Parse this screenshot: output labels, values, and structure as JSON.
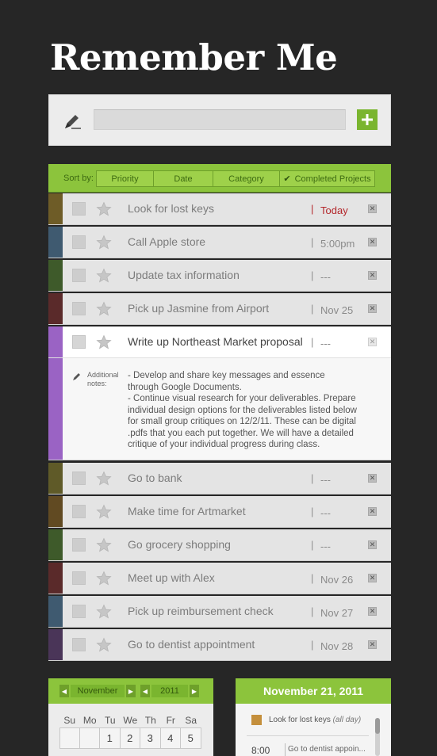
{
  "app": {
    "title": "Remember Me"
  },
  "add_bar": {
    "input_value": "",
    "add_icon": "plus-icon",
    "edit_icon": "pencil-icon"
  },
  "sort": {
    "label": "Sort by:",
    "options": [
      "Priority",
      "Date",
      "Category",
      "Completed Projects"
    ],
    "checked": "Completed Projects"
  },
  "colors": {
    "accent_green": "#8cc43c",
    "today_red": "#b3262a",
    "strip_olive": "#6e5c27",
    "strip_slate": "#3f5a70",
    "strip_moss": "#3e5a2a",
    "strip_maroon": "#5a2a2a",
    "strip_purple": "#9a63c4",
    "strip_gold": "#5f5a28",
    "strip_brown": "#614a22",
    "strip_grape": "#4a3558"
  },
  "tasks": [
    {
      "label": "Look for lost keys",
      "sep": "|",
      "due": "Today",
      "strip": "#6e5c27"
    },
    {
      "label": "Call Apple store",
      "sep": "|",
      "due": "5:00pm",
      "strip": "#3f5a70"
    },
    {
      "label": "Update tax information",
      "sep": "|",
      "due": "---",
      "strip": "#3e5a2a"
    },
    {
      "label": "Pick up Jasmine from Airport",
      "sep": "|",
      "due": "Nov 25",
      "strip": "#5a2a2a"
    },
    {
      "label": "Write up Northeast Market proposal",
      "sep": "|",
      "due": "---",
      "strip": "#9a63c4"
    },
    {
      "label": "Go to bank",
      "sep": "|",
      "due": "---",
      "strip": "#5f5a28"
    },
    {
      "label": "Make time for Artmarket",
      "sep": "|",
      "due": "---",
      "strip": "#614a22"
    },
    {
      "label": "Go grocery shopping",
      "sep": "|",
      "due": "---",
      "strip": "#3e5a2a"
    },
    {
      "label": "Meet up with Alex",
      "sep": "|",
      "due": "Nov 26",
      "strip": "#5a2a2a"
    },
    {
      "label": "Pick up reimbursement check",
      "sep": "|",
      "due": "Nov 27",
      "strip": "#3f5a70"
    },
    {
      "label": "Go to dentist appointment",
      "sep": "|",
      "due": "Nov 28",
      "strip": "#4a3558"
    }
  ],
  "notes": {
    "label_line1": "Additional",
    "label_line2": "notes:",
    "line1": "- Develop and share key messages and essence through Google Documents.",
    "line2": "- Continue visual research for your deliverables. Prepare individual design options for the deliverables listed below for small group critiques on 12/2/11. These can be digital .pdfs that you each put together. We will have a detailed critique of your individual progress during class."
  },
  "calendar": {
    "month": "November",
    "year": "2011",
    "weekdays": [
      "Su",
      "Mo",
      "Tu",
      "We",
      "Th",
      "Fr",
      "Sa"
    ],
    "first_row": [
      "",
      "",
      "1",
      "2",
      "3",
      "4",
      "5"
    ]
  },
  "day_panel": {
    "title": "November 21, 2011",
    "event1": "Look for lost keys",
    "event1_note": "(all day)",
    "time": "8:00",
    "event2": "Go to dentist appoin..."
  }
}
